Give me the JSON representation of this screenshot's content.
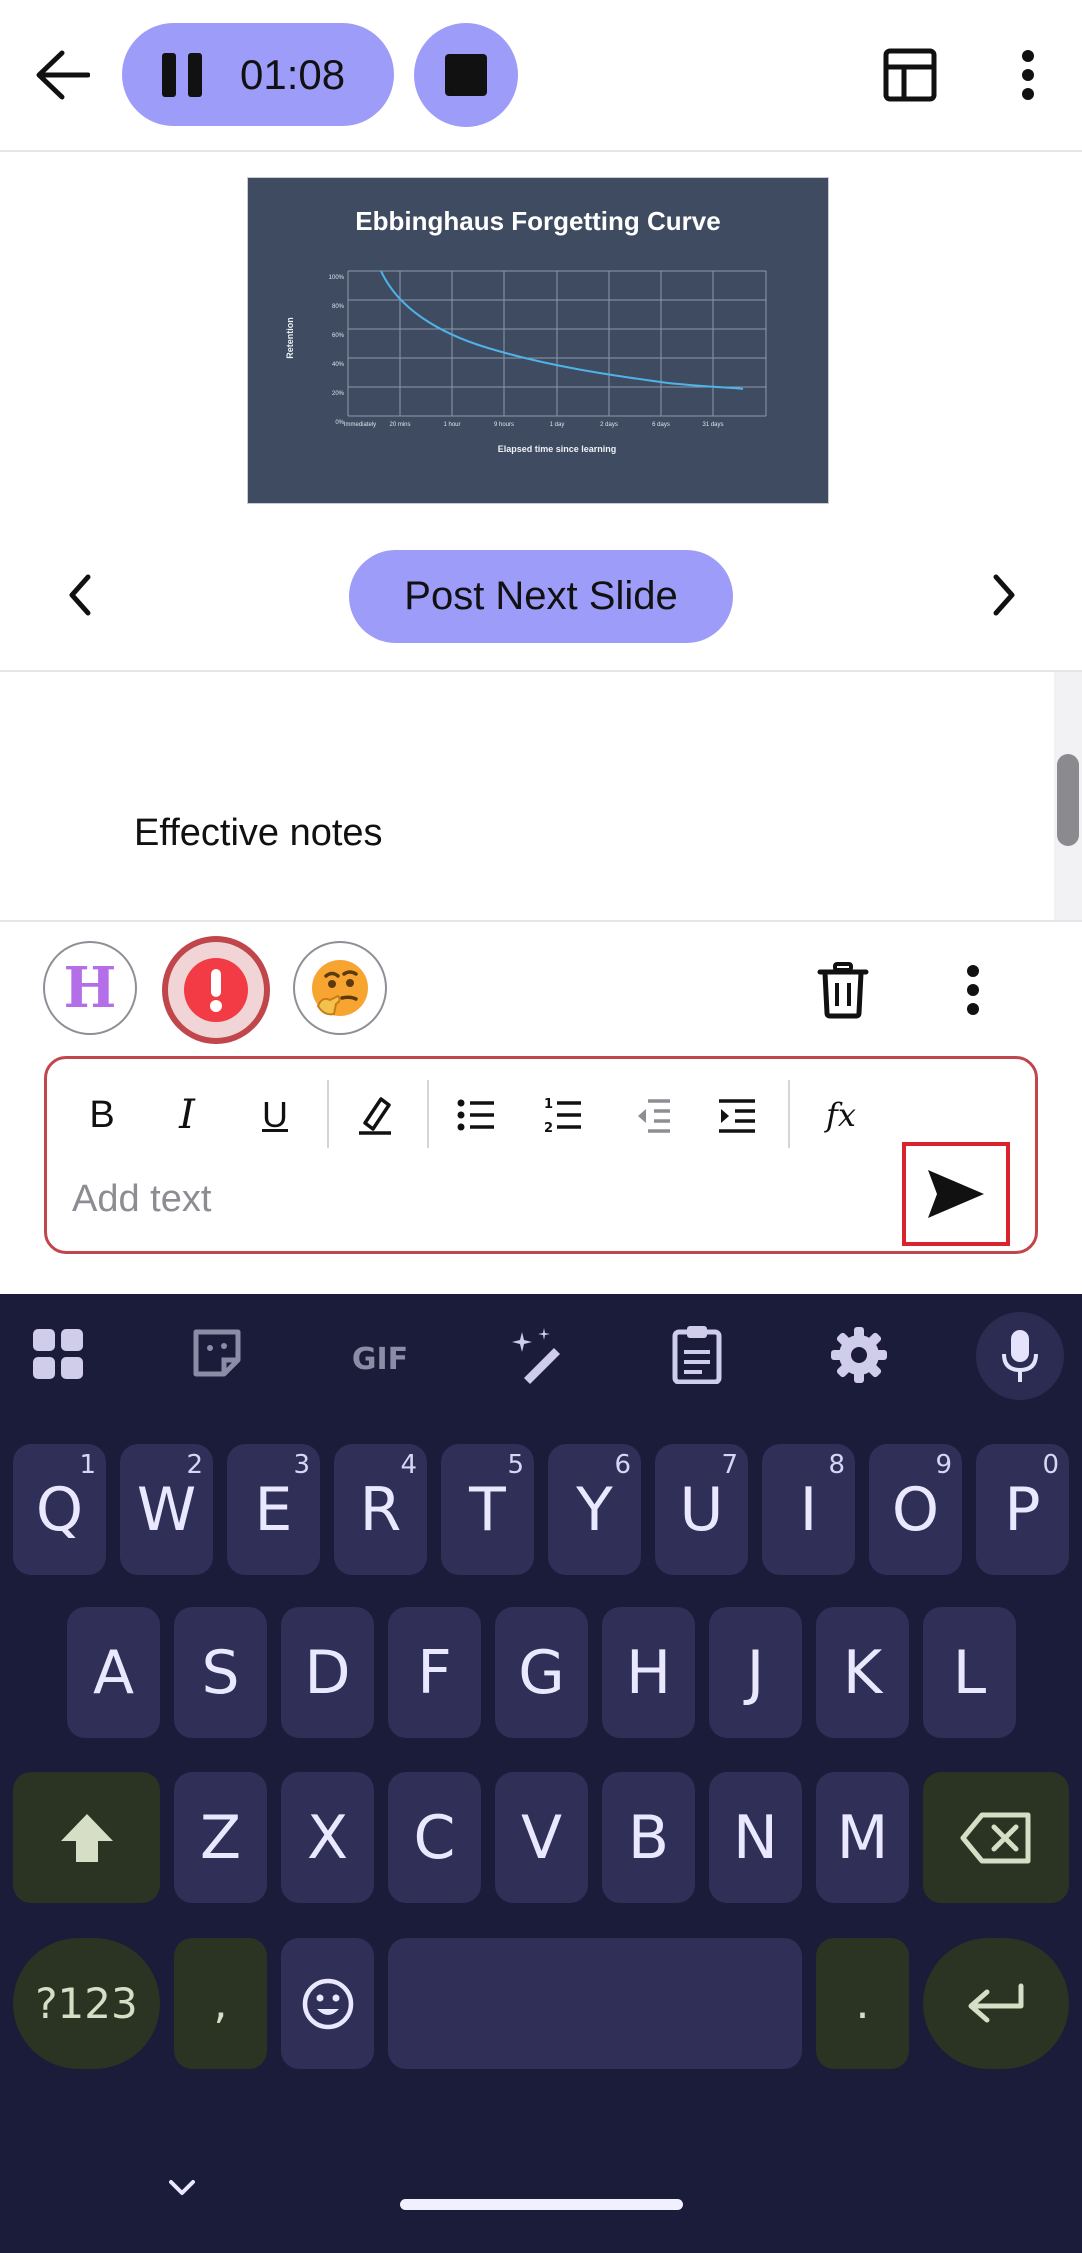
{
  "toolbar": {
    "timer": "01:08"
  },
  "slide": {
    "title": "Ebbinghaus Forgetting Curve",
    "ylabel": "Retention",
    "xlabel": "Elapsed time since learning",
    "yticks": [
      "100%",
      "80%",
      "60%",
      "40%",
      "20%",
      "0%"
    ],
    "xticks": [
      "Immediately",
      "20 mins",
      "1 hour",
      "9 hours",
      "1 day",
      "2 days",
      "6 days",
      "31 days"
    ]
  },
  "slide_nav": {
    "post_next_label": "Post Next Slide"
  },
  "notes": {
    "text": "Effective notes"
  },
  "reactions": {
    "h_label": "H"
  },
  "editor": {
    "placeholder": "Add text",
    "bold": "B",
    "italic": "I",
    "underline": "U",
    "formula": "fx"
  },
  "keyboard": {
    "row1": [
      {
        "key": "Q",
        "num": "1"
      },
      {
        "key": "W",
        "num": "2"
      },
      {
        "key": "E",
        "num": "3"
      },
      {
        "key": "R",
        "num": "4"
      },
      {
        "key": "T",
        "num": "5"
      },
      {
        "key": "Y",
        "num": "6"
      },
      {
        "key": "U",
        "num": "7"
      },
      {
        "key": "I",
        "num": "8"
      },
      {
        "key": "O",
        "num": "9"
      },
      {
        "key": "P",
        "num": "0"
      }
    ],
    "row2": [
      "A",
      "S",
      "D",
      "F",
      "G",
      "H",
      "J",
      "K",
      "L"
    ],
    "row3": [
      "Z",
      "X",
      "C",
      "V",
      "B",
      "N",
      "M"
    ],
    "symbols_label": "?123",
    "comma": ",",
    "period": ".",
    "gif_label": "GIF"
  },
  "colors": {
    "accent": "#9d9cf8",
    "keyboard_bg": "#1b1b3a",
    "key_bg": "#2f2f57",
    "key_dark": "#2b3322",
    "highlight_red": "#d9232d"
  }
}
